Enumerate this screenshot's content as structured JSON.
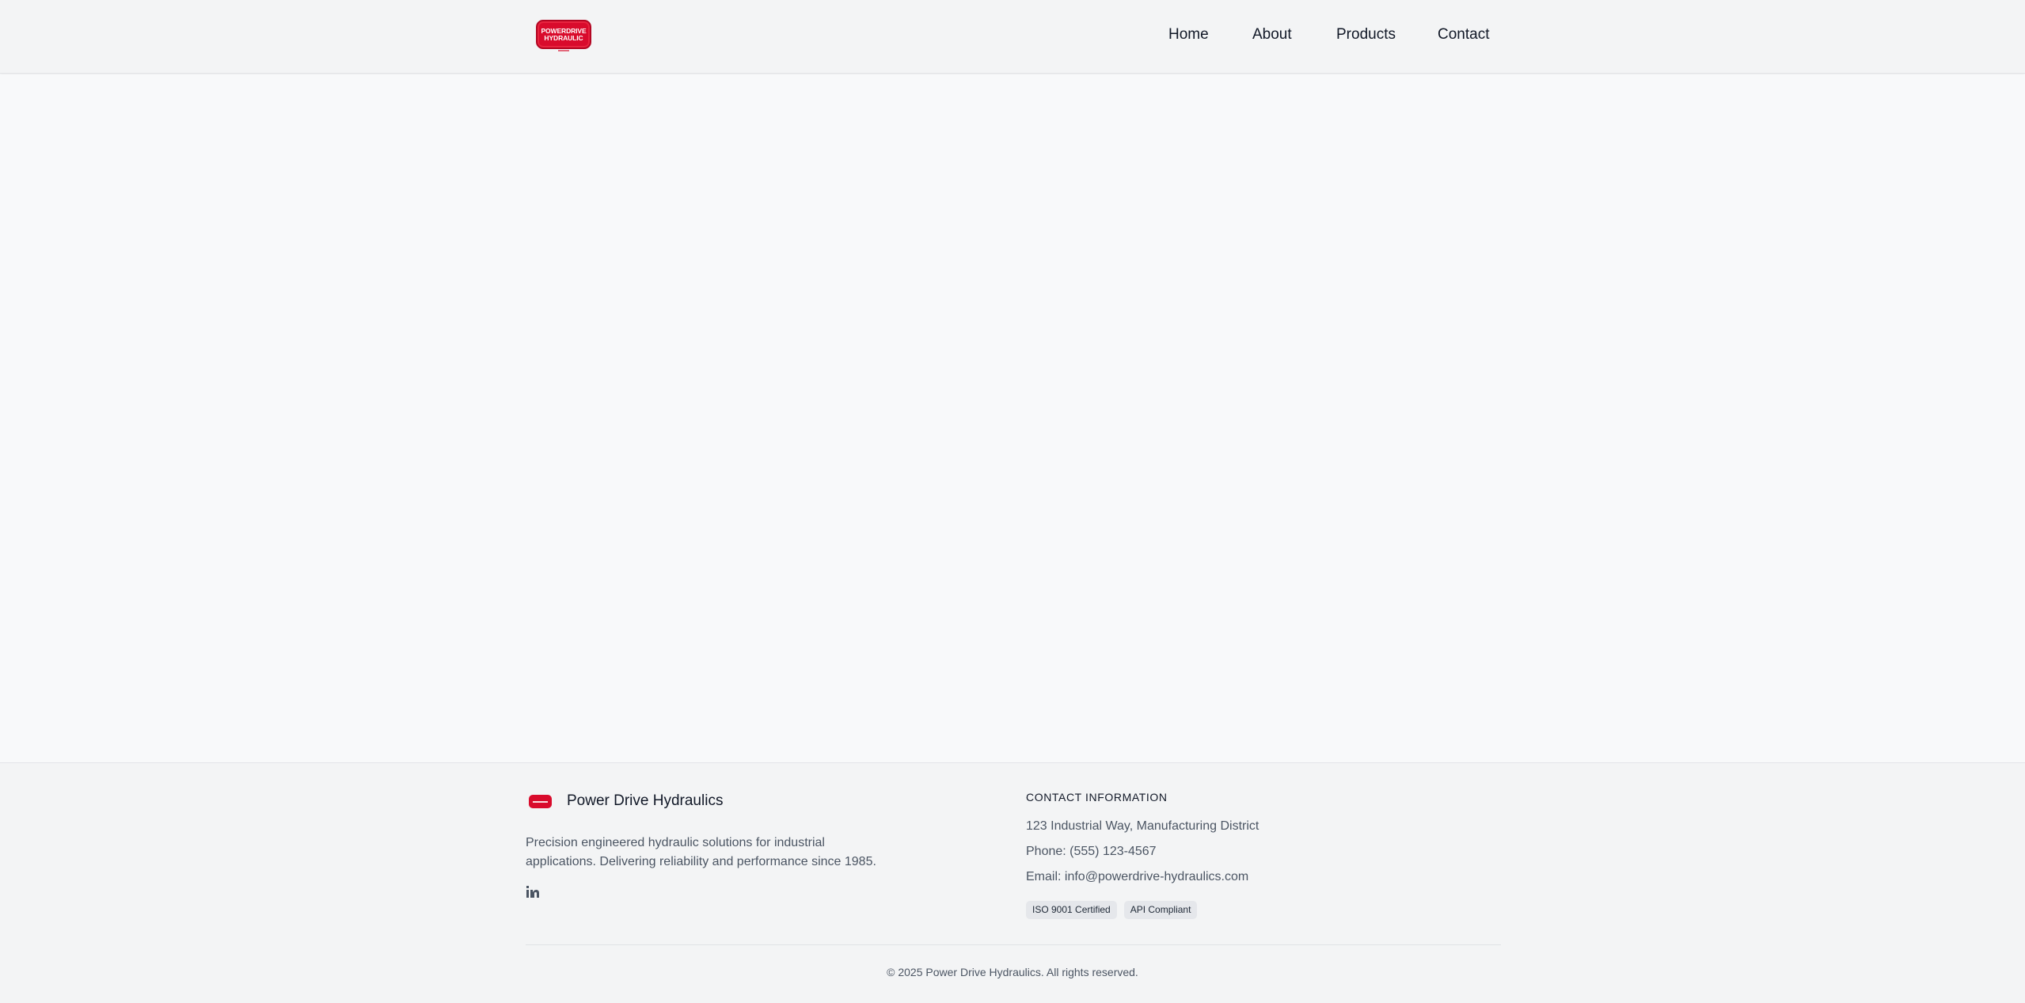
{
  "header": {
    "logo_text_line1": "POWERDRIVE",
    "logo_text_line2": "HYDRAULIC",
    "nav": {
      "home": "Home",
      "about": "About",
      "products": "Products",
      "contact": "Contact"
    }
  },
  "footer": {
    "brand_name": "Power Drive Hydraulics",
    "description": "Precision engineered hydraulic solutions for industrial applications. Delivering reliability and performance since 1985.",
    "social_icon": "linkedin-icon",
    "contact_title": "CONTACT INFORMATION",
    "address": "123 Industrial Way, Manufacturing District",
    "phone": "Phone: (555) 123-4567",
    "email": "Email: info@powerdrive-hydraulics.com",
    "badges": [
      "ISO 9001 Certified",
      "API Compliant"
    ],
    "copyright": "© 2025 Power Drive Hydraulics. All rights reserved."
  },
  "colors": {
    "brand_red": "#d90b2c",
    "background": "#f8f9fa",
    "header_bg": "#f3f4f5"
  }
}
